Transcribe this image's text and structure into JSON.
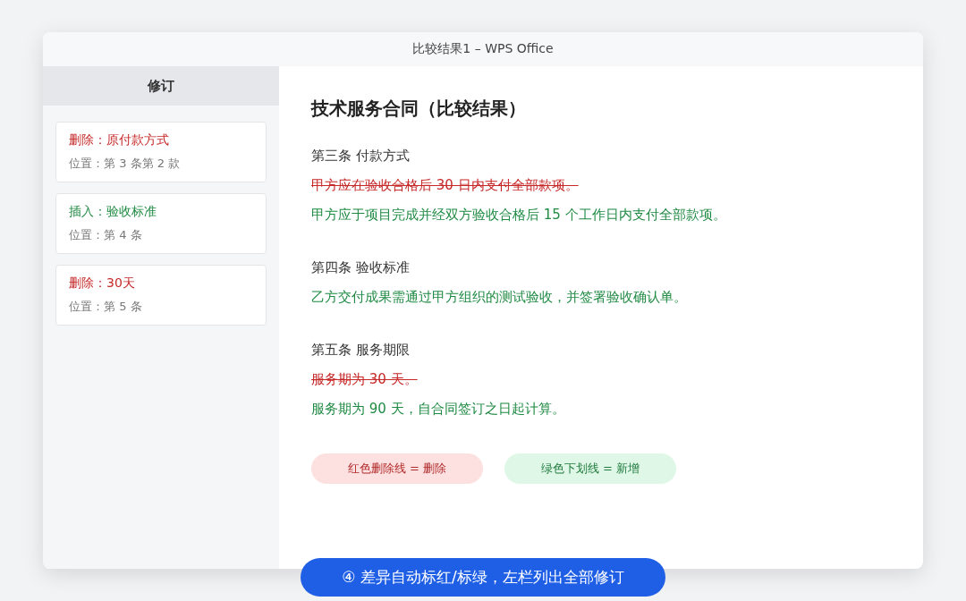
{
  "window": {
    "title": "比较结果1 – WPS Office"
  },
  "sidebar": {
    "title": "修订",
    "items": [
      {
        "kind": "delete",
        "label": "删除：原付款方式",
        "location": "位置：第 3 条第 2 款"
      },
      {
        "kind": "insert",
        "label": "插入：验收标准",
        "location": "位置：第 4 条"
      },
      {
        "kind": "delete",
        "label": "删除：30天",
        "location": "位置：第 5 条"
      }
    ]
  },
  "document": {
    "title": "技术服务合同（比较结果）",
    "sections": [
      {
        "heading": "第三条 付款方式",
        "paragraphs": [
          {
            "kind": "delete",
            "text": "甲方应在验收合格后 30 日内支付全部款项。"
          },
          {
            "kind": "insert",
            "text": "甲方应于项目完成并经双方验收合格后 15 个工作日内支付全部款项。"
          }
        ]
      },
      {
        "heading": "第四条 验收标准",
        "paragraphs": [
          {
            "kind": "insert",
            "text": "乙方交付成果需通过甲方组织的测试验收，并签署验收确认单。"
          }
        ]
      },
      {
        "heading": "第五条 服务期限",
        "paragraphs": [
          {
            "kind": "delete",
            "text": "服务期为 30 天。"
          },
          {
            "kind": "insert",
            "text": "服务期为 90 天，自合同签订之日起计算。"
          }
        ]
      }
    ],
    "legend": [
      {
        "kind": "delete",
        "text": "红色删除线 = 删除"
      },
      {
        "kind": "insert",
        "text": "绿色下划线 = 新增"
      }
    ]
  },
  "caption": "④ 差异自动标红/标绿，左栏列出全部修订"
}
